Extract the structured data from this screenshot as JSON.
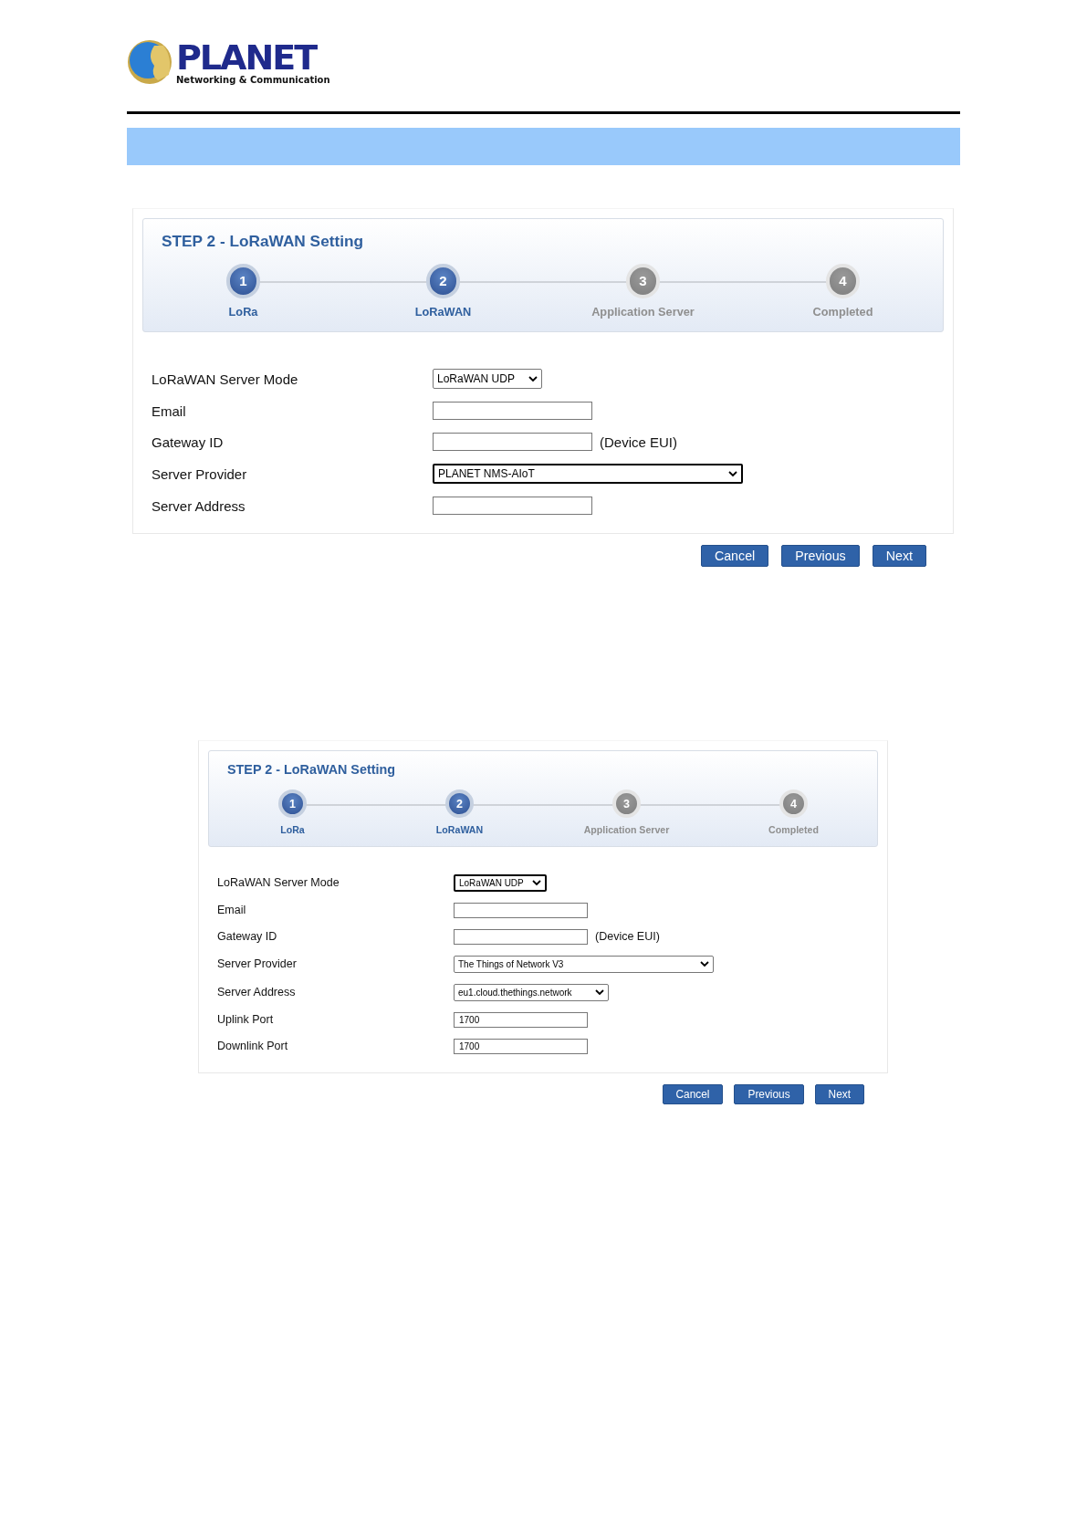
{
  "logo": {
    "brand": "PLANET",
    "tagline": "Networking & Communication"
  },
  "screens": [
    {
      "title": "STEP 2 - LoRaWAN Setting",
      "steps": [
        {
          "number": "1",
          "label": "LoRa",
          "active": true
        },
        {
          "number": "2",
          "label": "LoRaWAN",
          "active": true
        },
        {
          "number": "3",
          "label": "Application Server",
          "active": false
        },
        {
          "number": "4",
          "label": "Completed",
          "active": false
        }
      ],
      "rows": [
        {
          "label": "LoRaWAN Server Mode",
          "kind": "select",
          "value": "LoRaWAN UDP",
          "focused": false
        },
        {
          "label": "Email",
          "kind": "text"
        },
        {
          "label": "Gateway ID",
          "kind": "text",
          "suffix": "(Device EUI)"
        },
        {
          "label": "Server Provider",
          "kind": "select",
          "value": "PLANET NMS-AIoT",
          "focused": true
        },
        {
          "label": "Server Address",
          "kind": "text"
        }
      ],
      "buttons": [
        "Cancel",
        "Previous",
        "Next"
      ]
    },
    {
      "title": "STEP 2 - LoRaWAN Setting",
      "steps": [
        {
          "number": "1",
          "label": "LoRa",
          "active": true
        },
        {
          "number": "2",
          "label": "LoRaWAN",
          "active": true
        },
        {
          "number": "3",
          "label": "Application Server",
          "active": false
        },
        {
          "number": "4",
          "label": "Completed",
          "active": false
        }
      ],
      "rows": [
        {
          "label": "LoRaWAN Server Mode",
          "kind": "select",
          "value": "LoRaWAN UDP",
          "focused": true
        },
        {
          "label": "Email",
          "kind": "text"
        },
        {
          "label": "Gateway ID",
          "kind": "text",
          "suffix": "(Device EUI)"
        },
        {
          "label": "Server Provider",
          "kind": "select",
          "value": "The Things of Network V3",
          "focused": false
        },
        {
          "label": "Server Address",
          "kind": "select",
          "value": "eu1.cloud.thethings.network",
          "focused": false
        },
        {
          "label": "Uplink Port",
          "kind": "text",
          "value": "1700"
        },
        {
          "label": "Downlink Port",
          "kind": "text",
          "value": "1700"
        }
      ],
      "buttons": [
        "Cancel",
        "Previous",
        "Next"
      ]
    }
  ]
}
